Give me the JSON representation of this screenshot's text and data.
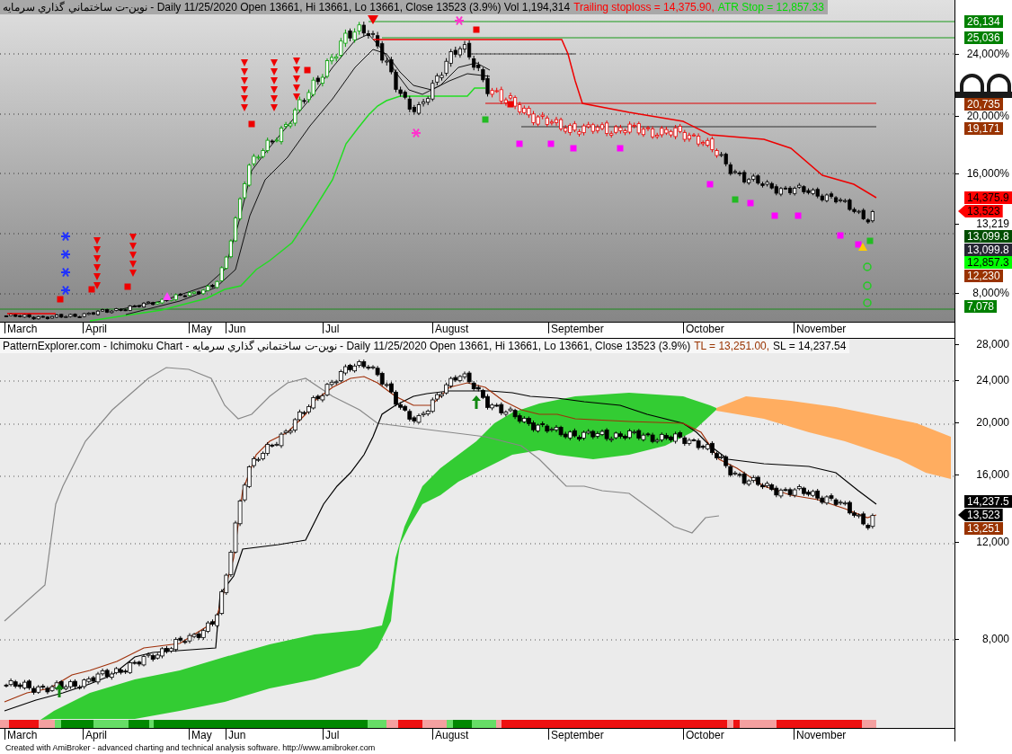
{
  "upper_chart": {
    "title_parts": [
      {
        "text": "نوین-ت ساختماني گذاري سرمايه - Daily 11/25/2020 Open 13661, Hi 13661, Lo 13661, Close 13523 (3.9%) Vol 1,194,314",
        "color": "#000000"
      },
      {
        "text": "Trailing stoploss = 14,375.90,",
        "color": "#ff0000"
      },
      {
        "text": "ATR Stop = 12,857.33",
        "color": "#00dd00"
      }
    ],
    "y_axis": [
      {
        "kind": "tag",
        "text": "26,134",
        "color": "#008000"
      },
      {
        "kind": "tag",
        "text": "25,036",
        "color": "#008000"
      },
      {
        "kind": "tick",
        "text": "24,000%"
      },
      {
        "kind": "tag",
        "text": "20,735",
        "color": "#993300"
      },
      {
        "kind": "tick",
        "text": "20,000%"
      },
      {
        "kind": "tag",
        "text": "19,171",
        "color": "#993300"
      },
      {
        "kind": "tick",
        "text": "16,000%"
      },
      {
        "kind": "tag",
        "text": "14,375.9",
        "color": "#ff0000"
      },
      {
        "kind": "pointer",
        "text": "13,523",
        "color": "#ff0000"
      },
      {
        "kind": "tick",
        "text": "13,219"
      },
      {
        "kind": "tag",
        "text": "13,099.8",
        "color": "#004d00"
      },
      {
        "kind": "tag",
        "text": "13,099.8",
        "color": "#262633"
      },
      {
        "kind": "tag",
        "text": "12,857.3",
        "color": "#00ff00"
      },
      {
        "kind": "tag",
        "text": "12,230",
        "color": "#993300"
      },
      {
        "kind": "tick",
        "text": "8,000%"
      },
      {
        "kind": "tag",
        "text": "7,078",
        "color": "#008000"
      }
    ],
    "x_axis": [
      "March",
      "April",
      "May",
      "Jun",
      "Jul",
      "August",
      "September",
      "October",
      "November"
    ]
  },
  "lower_chart": {
    "title_parts": [
      {
        "text": "PatternExplorer.com - Ichimoku Chart - نوین-ت ساختماني گذاري سرمايه - Daily 11/25/2020 Open 13661, Hi 13661, Lo 13661, Close 13523 (3.9%)",
        "color": "#000000"
      },
      {
        "text": "TL = 13,251.00,",
        "color": "#993300"
      },
      {
        "text": "SL = 14,237.54",
        "color": "#000000"
      }
    ],
    "y_axis": [
      {
        "kind": "tick",
        "text": "28,000"
      },
      {
        "kind": "tick",
        "text": "24,000"
      },
      {
        "kind": "tick",
        "text": "20,000"
      },
      {
        "kind": "tick",
        "text": "16,000"
      },
      {
        "kind": "tag",
        "text": "14,237.5",
        "color": "#000000"
      },
      {
        "kind": "pointer",
        "text": "13,523",
        "color": "#000000"
      },
      {
        "kind": "tag",
        "text": "13,251",
        "color": "#993300"
      },
      {
        "kind": "tick",
        "text": "12,000"
      },
      {
        "kind": "tick",
        "text": "8,000"
      }
    ],
    "x_axis": [
      "March",
      "April",
      "May",
      "Jun",
      "Jul",
      "August",
      "September",
      "October",
      "November"
    ]
  },
  "footer": "Created with AmiBroker - advanced charting and technical analysis software. http://www.amibroker.com"
}
